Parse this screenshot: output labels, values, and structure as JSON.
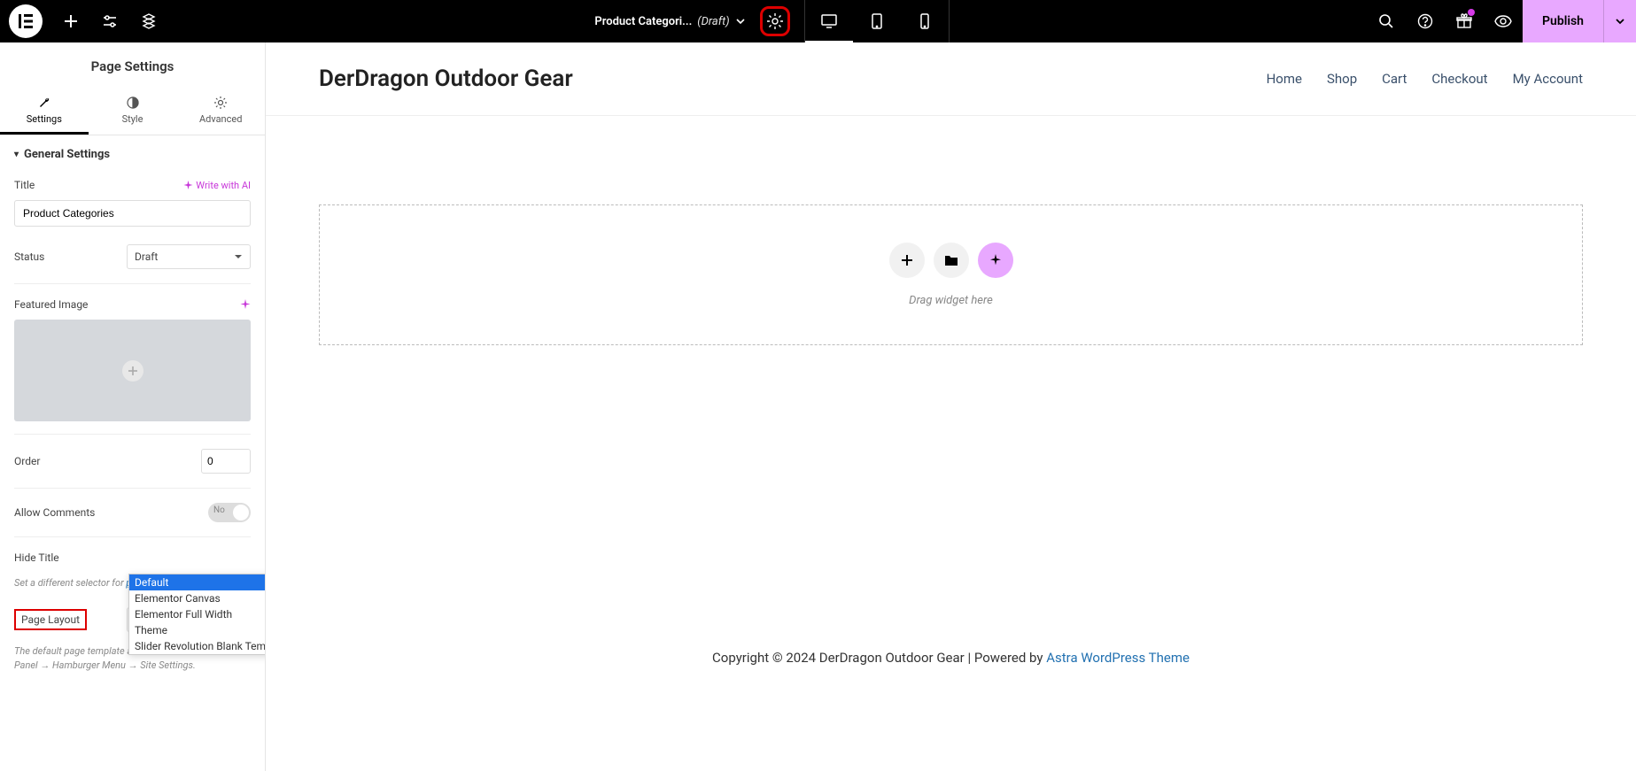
{
  "topbar": {
    "doc_title": "Product Categori...",
    "doc_status": "(Draft)",
    "publish_label": "Publish"
  },
  "sidebar": {
    "title": "Page Settings",
    "tabs": {
      "settings": "Settings",
      "style": "Style",
      "advanced": "Advanced"
    },
    "section_header": "General Settings",
    "title_row": {
      "label": "Title",
      "ai_action": "Write with AI",
      "value": "Product Categories"
    },
    "status_row": {
      "label": "Status",
      "value": "Draft"
    },
    "featured_row": {
      "label": "Featured Image"
    },
    "order_row": {
      "label": "Order",
      "value": "0"
    },
    "comments_row": {
      "label": "Allow Comments",
      "toggle_label": "No"
    },
    "hide_title_row": {
      "label": "Hide Title"
    },
    "hide_title_help_a": "Set a different selector for",
    "hide_title_help_link": "panel",
    "hide_title_help_b": ".",
    "page_layout_row": {
      "label": "Page Layout",
      "value": "Default"
    },
    "page_layout_help": "The default page template as defined in Elementor Panel → Hamburger Menu → Site Settings.",
    "layout_options": [
      "Default",
      "Elementor Canvas",
      "Elementor Full Width",
      "Theme",
      "Slider Revolution Blank Template"
    ]
  },
  "preview": {
    "site_title": "DerDragon Outdoor Gear",
    "nav": [
      "Home",
      "Shop",
      "Cart",
      "Checkout",
      "My Account"
    ],
    "drop_text": "Drag widget here",
    "footer_text": "Copyright © 2024 DerDragon Outdoor Gear | Powered by ",
    "footer_link": "Astra WordPress Theme"
  }
}
